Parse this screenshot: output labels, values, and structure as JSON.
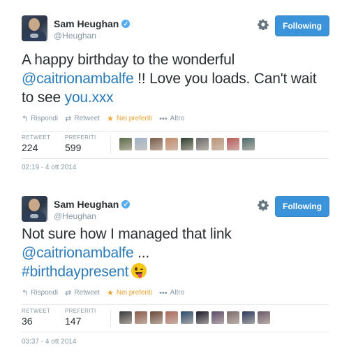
{
  "tweets": [
    {
      "display_name": "Sam Heughan",
      "verified_glyph": "✓",
      "handle": "@Heughan",
      "follow_label": "Following",
      "text_parts": {
        "a": "A happy birthday to the wonderful ",
        "mention": "@caitrionambalfe",
        "b": " !! Love you loads. Can't wait to see ",
        "link": "you.xxx"
      },
      "actions": {
        "reply": "Rispondi",
        "retweet": "Retweet",
        "favorite": "Nei preferiti",
        "more": "Altro"
      },
      "stats": {
        "retweet_label": "RETWEET",
        "retweet_count": "224",
        "favorite_label": "PREFERITI",
        "favorite_count": "599"
      },
      "favorited_by_colors": [
        "#5b6b4a",
        "#9fb0c4",
        "#7a5a4a",
        "#c08a6a",
        "#2c3c2a",
        "#6a6a6a",
        "#b8957a",
        "#b85a5a",
        "#4a6a6a"
      ],
      "timestamp": "02:19 - 4 ott 2014"
    },
    {
      "display_name": "Sam Heughan",
      "verified_glyph": "✓",
      "handle": "@Heughan",
      "follow_label": "Following",
      "text_parts": {
        "a": "Not sure how I managed that link ",
        "mention": "@caitrionambalfe",
        "b": " ...",
        "hashtag": "#birthdaypresent"
      },
      "actions": {
        "reply": "Rispondi",
        "retweet": "Retweet",
        "favorite": "Nei preferiti",
        "more": "Altro"
      },
      "stats": {
        "retweet_label": "RETWEET",
        "retweet_count": "36",
        "favorite_label": "PREFERITI",
        "favorite_count": "147"
      },
      "favorited_by_colors": [
        "#3a3a3a",
        "#8a5a4a",
        "#6a4a3a",
        "#a86a5a",
        "#2a4a6a",
        "#1a1a2a",
        "#5a4a6a",
        "#7a6a6a",
        "#2a3a5a",
        "#6a5a6a"
      ],
      "timestamp": "03:37 - 4 ott 2014"
    }
  ],
  "icons": {
    "gear": "gear-icon",
    "reply": "reply-icon",
    "retweet": "retweet-icon",
    "favorite": "star-icon",
    "more": "more-dots-icon",
    "verified": "verified-badge-icon",
    "emoji": "winking-tongue-face-emoji"
  },
  "colors": {
    "follow_button": "#3b94d9",
    "link": "#2b7bb9",
    "favorite_action": "#e8a130",
    "meta_text": "#8899a6"
  }
}
